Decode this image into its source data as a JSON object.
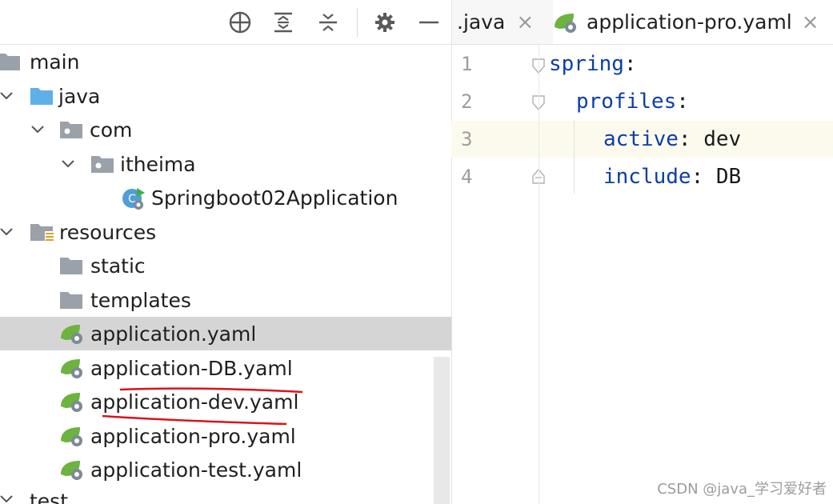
{
  "project_tree": {
    "toolbar_icons": [
      "crosshair-icon",
      "expand-all-icon",
      "collapse-all-icon",
      "gear-icon",
      "minimize-icon"
    ],
    "items": [
      {
        "label": "main",
        "icon": "folder-icon"
      },
      {
        "label": "java",
        "icon": "source-folder-icon"
      },
      {
        "label": "com",
        "icon": "package-icon"
      },
      {
        "label": "itheima",
        "icon": "package-icon"
      },
      {
        "label": "Springboot02Application",
        "icon": "spring-boot-class-icon"
      },
      {
        "label": "resources",
        "icon": "resources-folder-icon"
      },
      {
        "label": "static",
        "icon": "folder-icon"
      },
      {
        "label": "templates",
        "icon": "folder-icon"
      },
      {
        "label": "application.yaml",
        "icon": "spring-yaml-icon",
        "selected": true
      },
      {
        "label": "application-DB.yaml",
        "icon": "spring-yaml-icon"
      },
      {
        "label": "application-dev.yaml",
        "icon": "spring-yaml-icon"
      },
      {
        "label": "application-pro.yaml",
        "icon": "spring-yaml-icon"
      },
      {
        "label": "application-test.yaml",
        "icon": "spring-yaml-icon"
      },
      {
        "label": "test",
        "icon": "folder-icon"
      }
    ]
  },
  "editor": {
    "tabs": [
      {
        "label": ".java",
        "close": "×"
      },
      {
        "label": "application-pro.yaml",
        "close": "×",
        "icon": "spring-yaml-icon"
      }
    ],
    "lines": [
      {
        "number": "1",
        "key": "spring",
        "sep": ":",
        "value": ""
      },
      {
        "number": "2",
        "key": "profiles",
        "sep": ":",
        "value": ""
      },
      {
        "number": "3",
        "key": "active",
        "sep": ": ",
        "value": "dev"
      },
      {
        "number": "4",
        "key": "include",
        "sep": ": ",
        "value": "DB"
      }
    ],
    "current_line": 3
  },
  "colors": {
    "yaml_key": "#0b3ea8",
    "selection": "#d5d5d5",
    "current_line_bg": "#fcfaed",
    "annotation_red": "#d9141c",
    "spring_green": "#6db33f"
  },
  "watermark": "CSDN @java_学习爱好者"
}
